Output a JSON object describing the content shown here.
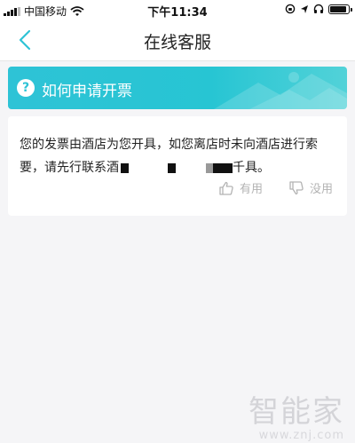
{
  "status_bar": {
    "carrier": "中国移动",
    "time": "下午11:34",
    "battery_level": 0.9
  },
  "navbar": {
    "title": "在线客服",
    "back_icon": "chevron-left-icon"
  },
  "banner": {
    "title": "如何申请开票",
    "icon": "question-icon",
    "icon_glyph": "?"
  },
  "answer": {
    "text_part1": "您的发票由酒店为您开具，如您离店时未向酒店进行索要，请先行联系酒",
    "text_part2": "千具。",
    "useful_label": "有用",
    "useless_label": "没用"
  },
  "watermark": {
    "logo": "智能家",
    "url": "www.znj.com"
  }
}
